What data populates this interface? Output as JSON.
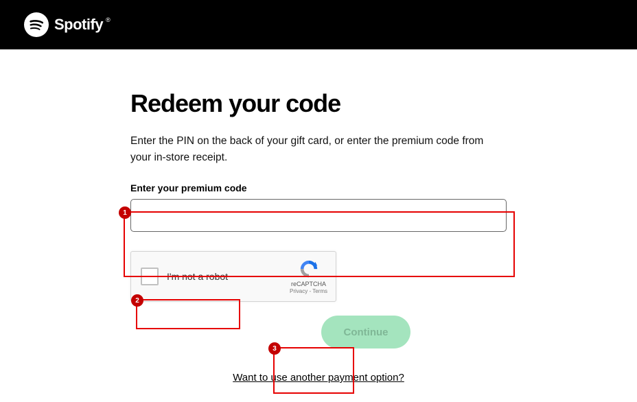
{
  "header": {
    "brand": "Spotify"
  },
  "page": {
    "title": "Redeem your code",
    "instructions": "Enter the PIN on the back of your gift card, or enter the premium code from your in-store receipt.",
    "input_label": "Enter your premium code",
    "input_value": ""
  },
  "recaptcha": {
    "label": "I'm not a robot",
    "brand": "reCAPTCHA",
    "privacy": "Privacy",
    "terms": "Terms"
  },
  "continue_label": "Continue",
  "payment_link": "Want to use another payment option?",
  "annotations": {
    "1": "1",
    "2": "2",
    "3": "3"
  }
}
